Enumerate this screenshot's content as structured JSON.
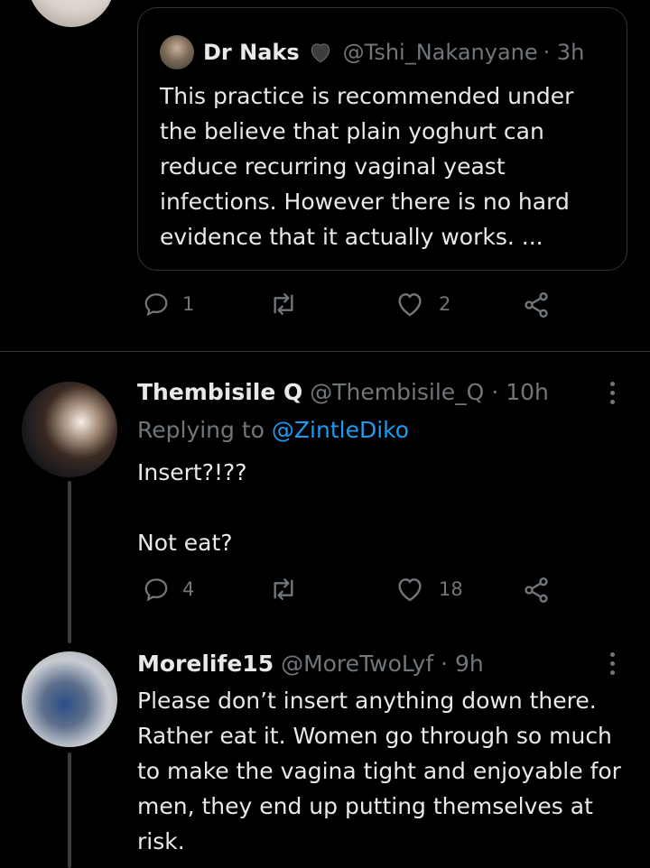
{
  "colors": {
    "background": "#000000",
    "text": "#e7e9ea",
    "muted": "#71767b",
    "accent": "#1d9bf0",
    "border": "#2f3336"
  },
  "quoted_tweet": {
    "name": "Dr Naks",
    "badge": "black-heart-emoji",
    "handle": "@Tshi_Nakanyane",
    "time": "· 3h",
    "text": "This practice is recommended under the believe that plain yoghurt can reduce recurring vaginal yeast infections. However there is no hard evidence that it actually works. ..."
  },
  "top_tweet_actions": {
    "replies": "1",
    "retweets": "",
    "likes": "2"
  },
  "replies": [
    {
      "name": "Thembisile Q",
      "handle": "@Thembisile_Q",
      "time": "· 10h",
      "replying_prefix": "Replying to",
      "replying_to": "@ZintleDiko",
      "text": "Insert?!??\n\nNot eat?",
      "replies": "4",
      "likes": "18"
    },
    {
      "name": "Morelife15",
      "handle": "@MoreTwoLyf",
      "time": "· 9h",
      "text": "Please don’t insert anything down there. Rather eat it. Women go through so much to make the vagina tight and enjoyable for men, they end up putting themselves at risk."
    }
  ]
}
